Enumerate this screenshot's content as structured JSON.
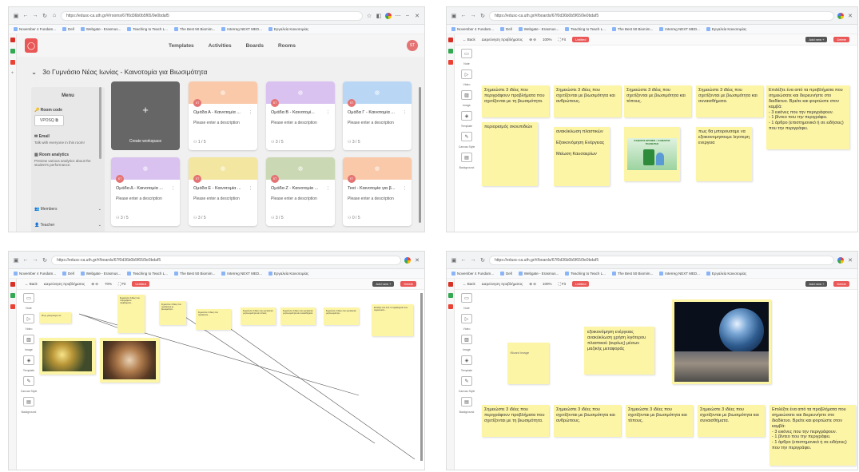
{
  "panel1": {
    "tab_icon": "app-icon",
    "url": "https://edusc-ca.uth.gr/#/rooms/67f0d36b0b5f65/9e0bdaf5",
    "bookmarks": [
      "November 4 Fundam...",
      "Dell",
      "Webgate - Erasmus...",
      "Teaching to Teach L...",
      "The Best 50 Biomim...",
      "Interreg NEXT MED...",
      "Εργαλεία Καινοτομίας"
    ],
    "nav": [
      "Templates",
      "Activities",
      "Boards",
      "Rooms"
    ],
    "avatar": "ST",
    "room_title": "3ο Γυμνάσιο Νέας Ιωνίας - Καινοτομία για Βιωσιμότητα",
    "menu": {
      "title": "Menu",
      "room_code_label": "Room code",
      "room_code": "VPOSQ",
      "email_label": "Email",
      "email_sub": "Talk with everyone in this room!",
      "analytics_label": "Room analytics",
      "analytics_sub": "Preview various analytics about the student's performance.",
      "members": "Members",
      "teacher": "Teacher"
    },
    "create_label": "Create workspace",
    "cards": [
      {
        "title": "Ομάδα Α - Καινοτομία ...",
        "desc": "Please enter a description",
        "count": "1 / 5",
        "color": "#f9c9a9"
      },
      {
        "title": "Ομάδα Β - Καινοτομί...",
        "desc": "Please enter a description",
        "count": "3 / 5",
        "color": "#d9c2f0"
      },
      {
        "title": "Ομάδα Γ - Καινοτομία ...",
        "desc": "Please enter a description",
        "count": "3 / 5",
        "color": "#b9d7f5"
      },
      {
        "title": "Ομάδα Δ - Καινοτομία ...",
        "desc": "Please enter a description",
        "count": "3 / 5",
        "color": "#d9c2f0"
      },
      {
        "title": "Ομάδα Ε - Καινοτομία ...",
        "desc": "Please enter a description",
        "count": "3 / 5",
        "color": "#f3e6a0"
      },
      {
        "title": "Ομάδα Ζ - Καινοτομία ...",
        "desc": "Please enter a description",
        "count": "3 / 5",
        "color": "#cbd8b4"
      },
      {
        "title": "Test - Καινοτομία για β...",
        "desc": "Please enter a description",
        "count": "0 / 5",
        "color": "#f9c9a9"
      }
    ]
  },
  "panel2": {
    "url": "https://edusc-ca.uth.gr/#/boards/67f0d36b0b5f65/9e0bdaf5",
    "back": "← Back",
    "board_title": "Διερεύνηση προβλήματος",
    "zoom": "100%",
    "fit": "Fit",
    "untitled": "Untitled",
    "add_new": "Add new +",
    "delete": "Delete",
    "tools": [
      "Note",
      "Video",
      "Image",
      "Template",
      "Canvas Style",
      "Background"
    ],
    "notes": [
      "Σημειώστε 3 ιδέες που περιγράφουν προβλήματα που σχετίζονται με τη βιωσιμότητα.",
      "Σημειώστε 3 ιδέες που σχετίζονται με βιωσιμότητα και ανθρώπους.",
      "Σημειώστε 3 ιδέες που σχετίζονται με βιωσιμότητα και τόπους.",
      "Σημειώστε 3 ιδέες που σχετίζονται με βιωσιμότητα και συναισθήματα.",
      "Επιλέξτε ένα από τα προβλήματα που σημειώσατε και διερευνήστε στο διαδίκτυο. Βρείτε και φορτώστε στον καμβά:\n- 3 εικόνες που την περιγράφουν.\n- 1 βίντεο που την περιγράφει.\n- 1 άρθρο (επιστημονικό ή σε ειδήσεις) που την περιγράφει."
    ],
    "sub_notes": [
      "περιορισμός σκουπιδιών",
      "ανακύκλωση πλαστικών\n\nΕξοικονόμηση Ενέργειας\n\nΜείωση Καυσαερίων",
      "πως θα μπορουσαμε να εξοικονομησουμε λιγοτερη ενεργεια"
    ],
    "recycle_caption": "ΚΑΘΑΡΟΙ ΔΡΟΜΟΙ = ΚΑΘΑΡΟΣ ΠΛΑΝΗΤΗΣ"
  },
  "panel3": {
    "url": "https://edusc-ca.uth.gr/#/boards/67f0d36b0b5f65/9e0bdaf5",
    "zoom": "70%",
    "notes_small": [
      "Σημειώστε 3 ιδέες που περιγράφουν προβλήματα...",
      "Σημειώστε 3 ιδέες που σχετίζονται με βιωσιμότητα...",
      "Σημειώστε 3 ιδέες που σχετίζονται...",
      "Σημειώστε 3 ιδέες που σχετίζονται με βιωσιμότητα και τόπους.",
      "Σημειώστε 3 ιδέες που σχετίζονται με βιωσιμότητα και συναισθήματα.",
      "Σημειώστε 3 ιδέες που σχετίζονται με βιωσιμότητα...",
      "Επιλέξτε ένα από τα προβλήματα που σημειώσατε..."
    ],
    "sub_small": [
      "Πως μπορουμε να",
      "Απορριμματα..."
    ]
  },
  "panel4": {
    "url": "https://edusc-ca.uth.gr/#/boards/67f0d36b0b5f65/9e0bdaf5",
    "zoom": "100%",
    "center_note": "εξοικονόμηση ενέργειας ανακύκλωση χρήση λιγότερου πλαστικού (κυρίως) μέσων μαζικής μεταφοράς",
    "alt_image": "Board image"
  },
  "colors": {
    "accent": "#ea5757",
    "note": "#fdf5a6"
  }
}
